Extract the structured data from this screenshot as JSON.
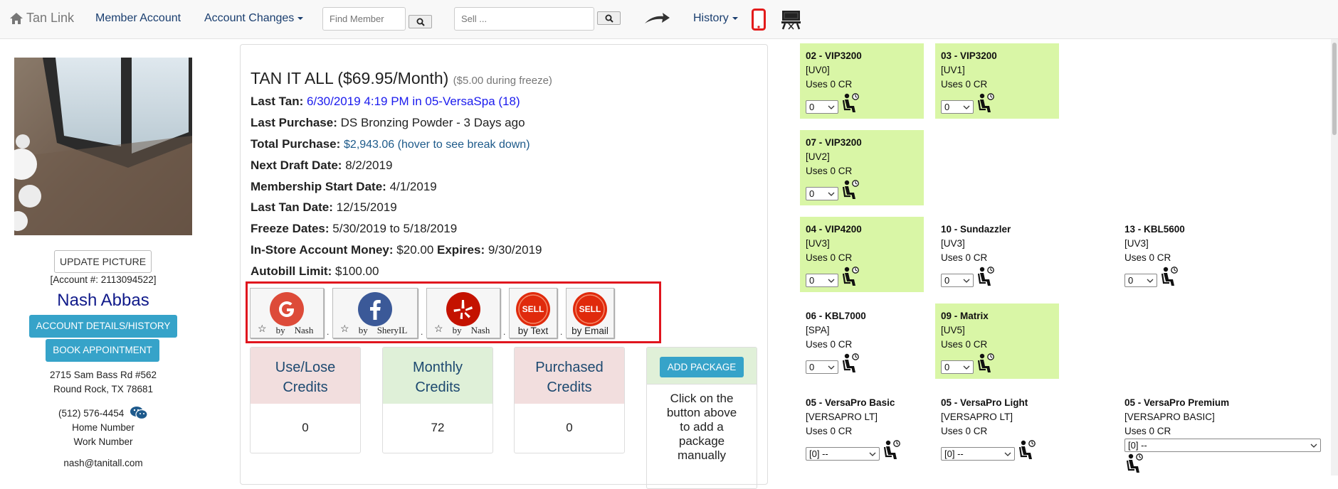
{
  "nav": {
    "brand": "Tan Link",
    "member_account": "Member Account",
    "account_changes": "Account Changes",
    "find_member_placeholder": "Find Member",
    "sell_placeholder": "Sell ...",
    "history": "History"
  },
  "profile": {
    "update_picture": "UPDATE PICTURE",
    "account_number": "[Account #: 2113094522]",
    "name": "Nash Abbas",
    "account_details": "ACCOUNT DETAILS/HISTORY",
    "book_appointment": "BOOK APPOINTMENT",
    "address1": "2715 Sam Bass Rd #562",
    "address2": "Round Rock, TX 78681",
    "phone": "(512) 576-4454",
    "home_number": "Home Number",
    "work_number": "Work Number",
    "email": "nash@tanitall.com"
  },
  "membership": {
    "plan": "TAN IT ALL ($69.95/Month)",
    "freeze_note": "($5.00 during freeze)",
    "last_tan_label": "Last Tan:",
    "last_tan_value": "6/30/2019 4:19 PM in 05-VersaSpa (18)",
    "last_purchase_label": "Last Purchase:",
    "last_purchase_value": "DS Bronzing Powder - 3 Days ago",
    "total_purchase_label": "Total Purchase:",
    "total_purchase_value": "$2,943.06 (hover to see break down)",
    "next_draft_label": "Next Draft Date:",
    "next_draft_value": "8/2/2019",
    "start_label": "Membership Start Date:",
    "start_value": "4/1/2019",
    "last_tan_date_label": "Last Tan Date:",
    "last_tan_date_value": "12/15/2019",
    "freeze_label": "Freeze Dates:",
    "freeze_value": "5/30/2019 to 5/18/2019",
    "instore_label": "In-Store Account Money:",
    "instore_value": "$20.00",
    "expires_label": "Expires:",
    "expires_value": "9/30/2019",
    "autobill_label": "Autobill Limit:",
    "autobill_value": "$100.00"
  },
  "reviews": [
    {
      "icon": "google-icon",
      "star": "☆",
      "by": "by",
      "who": "Nash",
      "color": "#dd4b39"
    },
    {
      "icon": "facebook-icon",
      "star": "☆",
      "by": "by",
      "who": "SheryIL",
      "color": "#3b5998"
    },
    {
      "icon": "yelp-icon",
      "star": "☆",
      "by": "by",
      "who": "Nash",
      "color": "#c41200"
    },
    {
      "icon": "sell-text-icon",
      "label": "SELL",
      "caption": "by Text",
      "color": "#e02a0c"
    },
    {
      "icon": "sell-email-icon",
      "label": "SELL",
      "caption": "by Email",
      "color": "#e02a0c"
    }
  ],
  "credits": [
    {
      "label_line1": "Use/Lose",
      "label_line2": "Credits",
      "value": "0",
      "color": "#f2dede"
    },
    {
      "label_line1": "Monthly",
      "label_line2": "Credits",
      "value": "72",
      "color": "#dff0d8"
    },
    {
      "label_line1": "Purchased",
      "label_line2": "Credits",
      "value": "0",
      "color": "#f2dede"
    }
  ],
  "package": {
    "add_label": "ADD PACKAGE",
    "text_lines": [
      "Click on the",
      "button above",
      "to add a",
      "package",
      "manually"
    ]
  },
  "beds": [
    {
      "title": "02 - VIP3200",
      "type": "[UV0]",
      "uses": "Uses 0 CR",
      "select": "0",
      "green": true
    },
    {
      "title": "03 - VIP3200",
      "type": "[UV1]",
      "uses": "Uses 0 CR",
      "select": "0",
      "green": true
    },
    {
      "title": "07 - VIP3200",
      "type": "[UV2]",
      "uses": "Uses 0 CR",
      "select": "0",
      "green": true
    },
    {
      "title": "04 - VIP4200",
      "type": "[UV3]",
      "uses": "Uses 0 CR",
      "select": "0",
      "green": true
    },
    {
      "title": "10 - Sundazzler",
      "type": "[UV3]",
      "uses": "Uses 0 CR",
      "select": "0",
      "green": false
    },
    {
      "title": "13 - KBL5600",
      "type": "[UV3]",
      "uses": "Uses 0 CR",
      "select": "0",
      "green": false
    },
    {
      "title": "06 - KBL7000",
      "type": "[SPA]",
      "uses": "Uses 0 CR",
      "select": "0",
      "green": false
    },
    {
      "title": "09 - Matrix",
      "type": "[UV5]",
      "uses": "Uses 0 CR",
      "select": "0",
      "green": true
    },
    {
      "title": "05 - VersaPro Basic",
      "type": "[VERSAPRO LT]",
      "uses": "Uses 0 CR",
      "select": "[0] --",
      "green": false
    },
    {
      "title": "05 - VersaPro Light",
      "type": "[VERSAPRO LT]",
      "uses": "Uses 0 CR",
      "select": "[0] --",
      "green": false
    },
    {
      "title": "05 - VersaPro Premium",
      "type": "[VERSAPRO BASIC]",
      "uses": "Uses 0 CR",
      "select": "[0] --",
      "green": false
    }
  ]
}
